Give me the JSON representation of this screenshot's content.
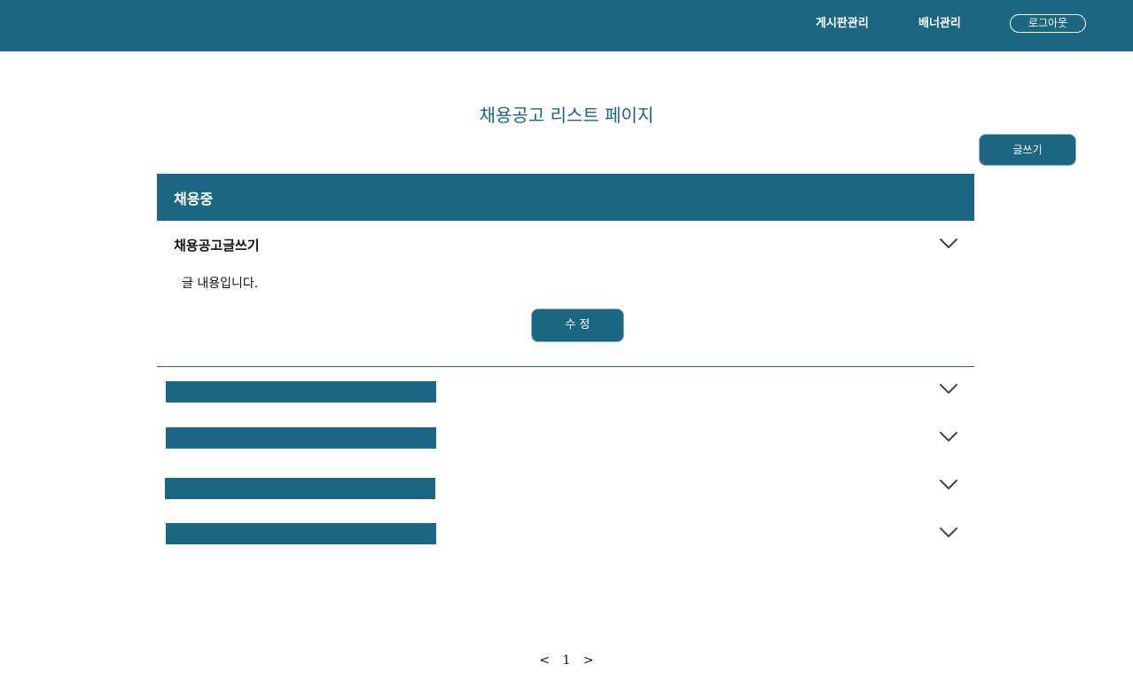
{
  "header": {
    "nav": [
      "게시판관리",
      "배너관리"
    ],
    "logout_label": "로그아웃",
    "background_color": "#1b6682"
  },
  "page": {
    "title": "채용공고 리스트 페이지",
    "write_button_label": "글쓰기"
  },
  "section": {
    "label": "채용중"
  },
  "open_post": {
    "title": "채용공고글쓰기",
    "body": "글 내용입니다.",
    "edit_button_label": "수 정",
    "toggle_icon": "chevron-down-icon"
  },
  "collapsed_rows": [
    {
      "icon": "chevron-down-icon"
    },
    {
      "icon": "chevron-down-icon"
    },
    {
      "icon": "chevron-down-icon"
    },
    {
      "icon": "chevron-down-icon"
    }
  ],
  "pagination": {
    "prev": "<",
    "current": "1",
    "next": ">"
  }
}
